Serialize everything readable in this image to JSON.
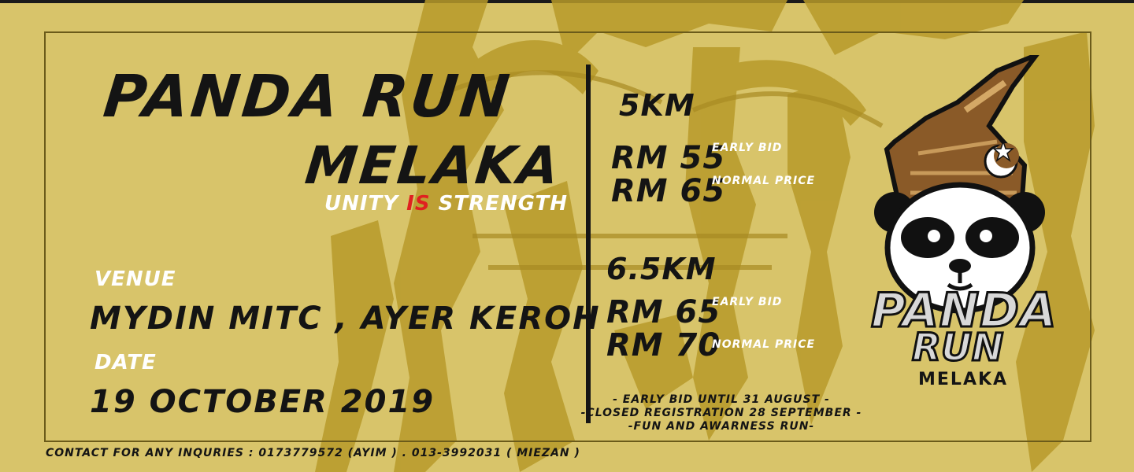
{
  "event": {
    "title_line1": "PANDA RUN",
    "title_line2": "MELAKA",
    "tagline_part1": "UNITY ",
    "tagline_highlight": "IS",
    "tagline_part2": " STRENGTH",
    "venue_label": "VENUE",
    "venue": "MYDIN MITC , AYER KEROH",
    "date_label": "DATE",
    "date": "19 OCTOBER 2019"
  },
  "categories": [
    {
      "distance": "5KM",
      "prices": [
        {
          "price": "RM 55",
          "label": "EARLY BID"
        },
        {
          "price": "RM 65",
          "label": "NORMAL PRICE"
        }
      ]
    },
    {
      "distance": "6.5KM",
      "prices": [
        {
          "price": "RM 65",
          "label": "EARLY BID"
        },
        {
          "price": "RM 70",
          "label": "NORMAL PRICE"
        }
      ]
    }
  ],
  "notes": [
    "- EARLY BID UNTIL 31 AUGUST -",
    "-CLOSED REGISTRATION 28 SEPTEMBER -",
    "-FUN AND AWARNESS RUN-"
  ],
  "contact": "CONTACT FOR ANY INQURIES : 0173779572 (AYIM ) . 013-3992031 ( MIEZAN )",
  "logo": {
    "word1": "PANDA",
    "word2": "RUN",
    "city": "MELAKA",
    "icon": "panda-mascot-icon"
  },
  "colors": {
    "background": "#d8c46a",
    "texture": "#b89a2a",
    "text": "#141414",
    "accent_white": "#ffffff",
    "accent_red": "#e02020"
  }
}
